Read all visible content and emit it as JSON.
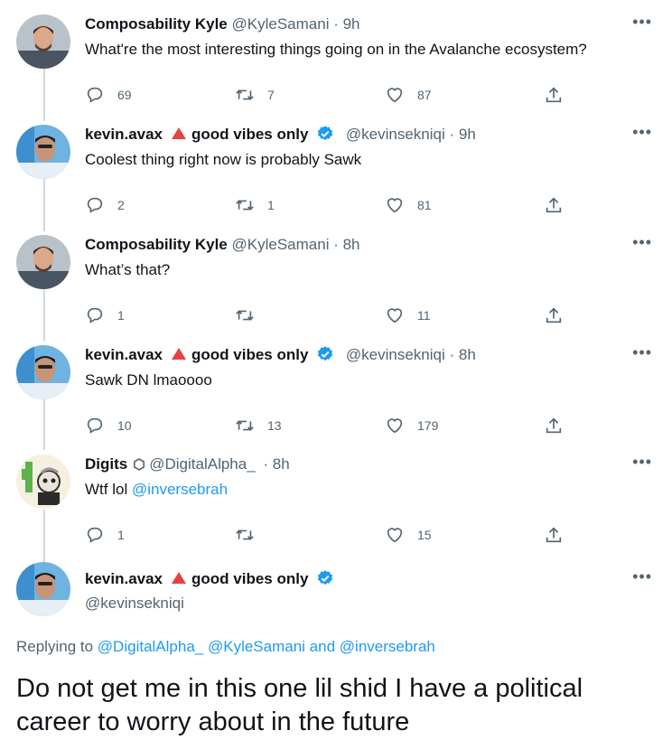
{
  "tweets": [
    {
      "name": "Composability Kyle",
      "handle": "@KyleSamani",
      "time": "9h",
      "text": "What're the most interesting things going on in the Avalanche ecosystem?",
      "replies": "69",
      "retweets": "7",
      "likes": "87"
    },
    {
      "name": "kevin.avax",
      "name_suffix": "good vibes only",
      "handle": "@kevinsekniqi",
      "time": "9h",
      "text": "Coolest thing right now is probably Sawk",
      "replies": "2",
      "retweets": "1",
      "likes": "81"
    },
    {
      "name": "Composability Kyle",
      "handle": "@KyleSamani",
      "time": "8h",
      "text": "What’s that?",
      "replies": "1",
      "retweets": "",
      "likes": "11"
    },
    {
      "name": "kevin.avax",
      "name_suffix": "good vibes only",
      "handle": "@kevinsekniqi",
      "time": "8h",
      "text": "Sawk DN lmaoooo",
      "replies": "10",
      "retweets": "13",
      "likes": "179"
    },
    {
      "name": "Digits",
      "handle": "@DigitalAlpha_",
      "time": "8h",
      "text": "Wtf lol",
      "mention": "@inversebrah",
      "replies": "1",
      "retweets": "",
      "likes": "15"
    }
  ],
  "main": {
    "name": "kevin.avax",
    "name_suffix": "good vibes only",
    "handle": "@kevinsekniqi",
    "replying_prefix": "Replying to",
    "replying_1": "@DigitalAlpha_",
    "replying_2": "@KyleSamani",
    "replying_and": "and",
    "replying_3": "@inversebrah",
    "text": "Do not get me in this one lil shid I have a political career to worry about in the future"
  },
  "separator": "·",
  "more_glyph": "•••",
  "icons": {
    "reply": "reply-icon",
    "retweet": "retweet-icon",
    "like": "heart-icon",
    "share": "share-icon",
    "verified": "verified-badge-icon",
    "avalanche": "avalanche-triangle-icon",
    "hexagon": "hexagon-icon"
  },
  "colors": {
    "text": "#0f1419",
    "secondary": "#536471",
    "link": "#1d9bf0",
    "avalanche_red": "#e84142",
    "thread_line": "#cfd9de"
  }
}
